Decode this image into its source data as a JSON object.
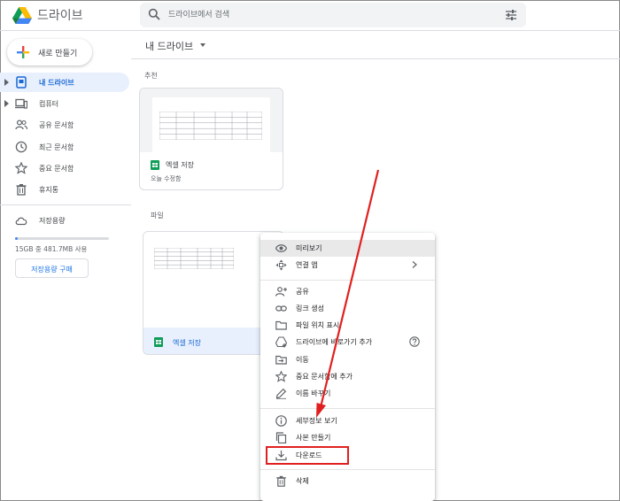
{
  "header": {
    "app_title": "드라이브",
    "search_placeholder": "드라이브에서 검색"
  },
  "sidebar": {
    "new_label": "새로 만들기",
    "items": [
      {
        "label": "내 드라이브",
        "icon": "my-drive-icon",
        "active": true,
        "expandable": true
      },
      {
        "label": "컴퓨터",
        "icon": "computer-icon",
        "active": false,
        "expandable": true
      },
      {
        "label": "공유 문서함",
        "icon": "shared-people-icon",
        "active": false,
        "expandable": false
      },
      {
        "label": "최근 문서함",
        "icon": "clock-icon",
        "active": false,
        "expandable": false
      },
      {
        "label": "중요 문서함",
        "icon": "star-icon",
        "active": false,
        "expandable": false
      },
      {
        "label": "휴지통",
        "icon": "trash-icon",
        "active": false,
        "expandable": false
      }
    ],
    "storage": {
      "label": "저장용량",
      "usage_text": "15GB 중 481.7MB 사용",
      "used_fraction": 0.03,
      "buy_label": "저장용량 구매"
    }
  },
  "main": {
    "title": "내 드라이브",
    "suggested_label": "추천",
    "files_label": "파일",
    "suggested_card": {
      "title": "엑셀 저장",
      "subtitle": "오늘 수정함"
    },
    "file_card": {
      "title": "엑셀 저장"
    }
  },
  "context_menu": {
    "groups": [
      [
        {
          "label": "미리보기",
          "icon": "eye-icon",
          "highlighted": true
        },
        {
          "label": "연결 앱",
          "icon": "open-with-icon",
          "submenu": true
        }
      ],
      [
        {
          "label": "공유",
          "icon": "person-add-icon"
        },
        {
          "label": "링크 생성",
          "icon": "link-icon"
        },
        {
          "label": "파일 위치 표시",
          "icon": "folder-icon"
        },
        {
          "label": "드라이브에 바로가기 추가",
          "icon": "drive-shortcut-icon",
          "help": true
        },
        {
          "label": "이동",
          "icon": "move-to-folder-icon"
        },
        {
          "label": "중요 문서함에 추가",
          "icon": "star-icon"
        },
        {
          "label": "이름 바꾸기",
          "icon": "pencil-icon"
        }
      ],
      [
        {
          "label": "세부정보 보기",
          "icon": "info-icon"
        },
        {
          "label": "사본 만들기",
          "icon": "copy-icon"
        },
        {
          "label": "다운로드",
          "icon": "download-icon"
        }
      ],
      [
        {
          "label": "삭제",
          "icon": "trash-icon"
        }
      ]
    ]
  },
  "annotation": {
    "highlight_color": "#e02020"
  },
  "colors": {
    "accent": "#1a73e8",
    "active_bg": "#e8f0fe",
    "sheets_green": "#0f9d58"
  }
}
